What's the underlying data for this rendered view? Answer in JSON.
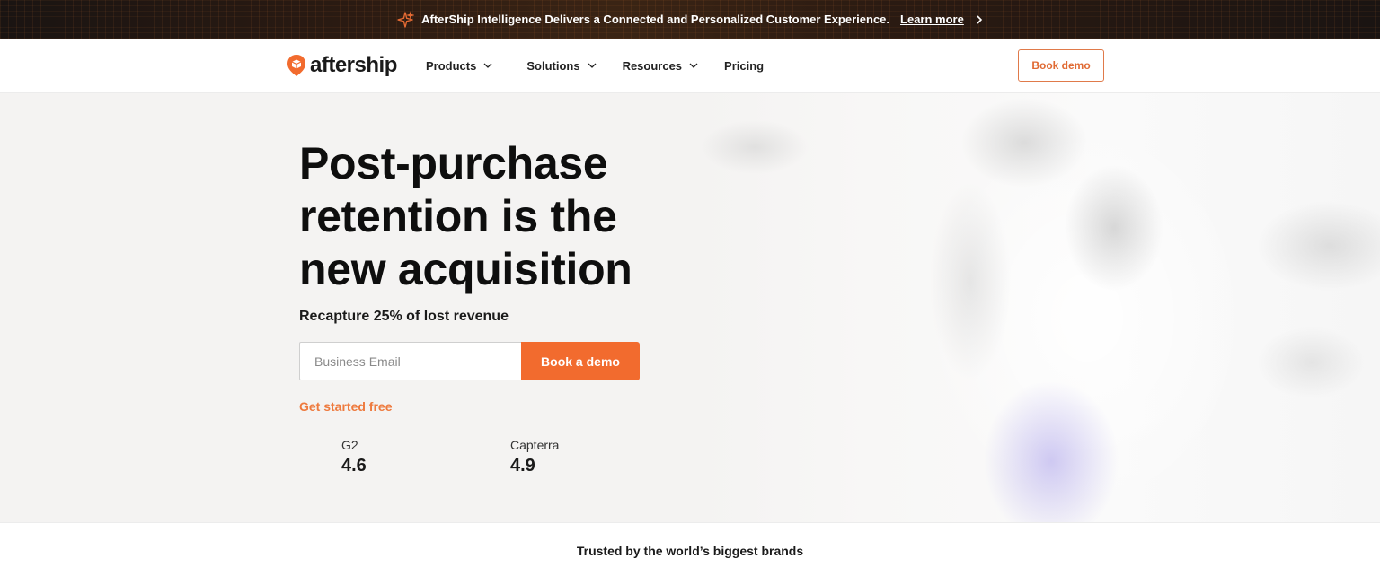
{
  "announcement": {
    "message": "AfterShip Intelligence Delivers a Connected and Personalized Customer Experience.",
    "link_label": "Learn more",
    "icon": "sparkle-icon"
  },
  "nav": {
    "logo_text": "aftership",
    "items": [
      {
        "label": "Products",
        "has_dropdown": true
      },
      {
        "label": "Solutions",
        "has_dropdown": true
      },
      {
        "label": "Resources",
        "has_dropdown": true
      },
      {
        "label": "Pricing",
        "has_dropdown": false
      }
    ],
    "book_demo_label": "Book demo"
  },
  "hero": {
    "headline": "Post-purchase retention is the new acquisition",
    "subhead": "Recapture 25% of lost revenue",
    "email_placeholder": "Business Email",
    "email_value": "",
    "cta_label": "Book a demo",
    "secondary_link": "Get started free",
    "ratings": [
      {
        "source": "G2",
        "score": "4.6"
      },
      {
        "source": "Capterra",
        "score": "4.9"
      }
    ]
  },
  "trusted": {
    "text": "Trusted by the world’s biggest brands"
  },
  "colors": {
    "accent": "#f26b2e",
    "accent_text": "#ee7a3e",
    "announcement_bg": "#1a1412",
    "hero_bg": "#f4f3f2"
  }
}
